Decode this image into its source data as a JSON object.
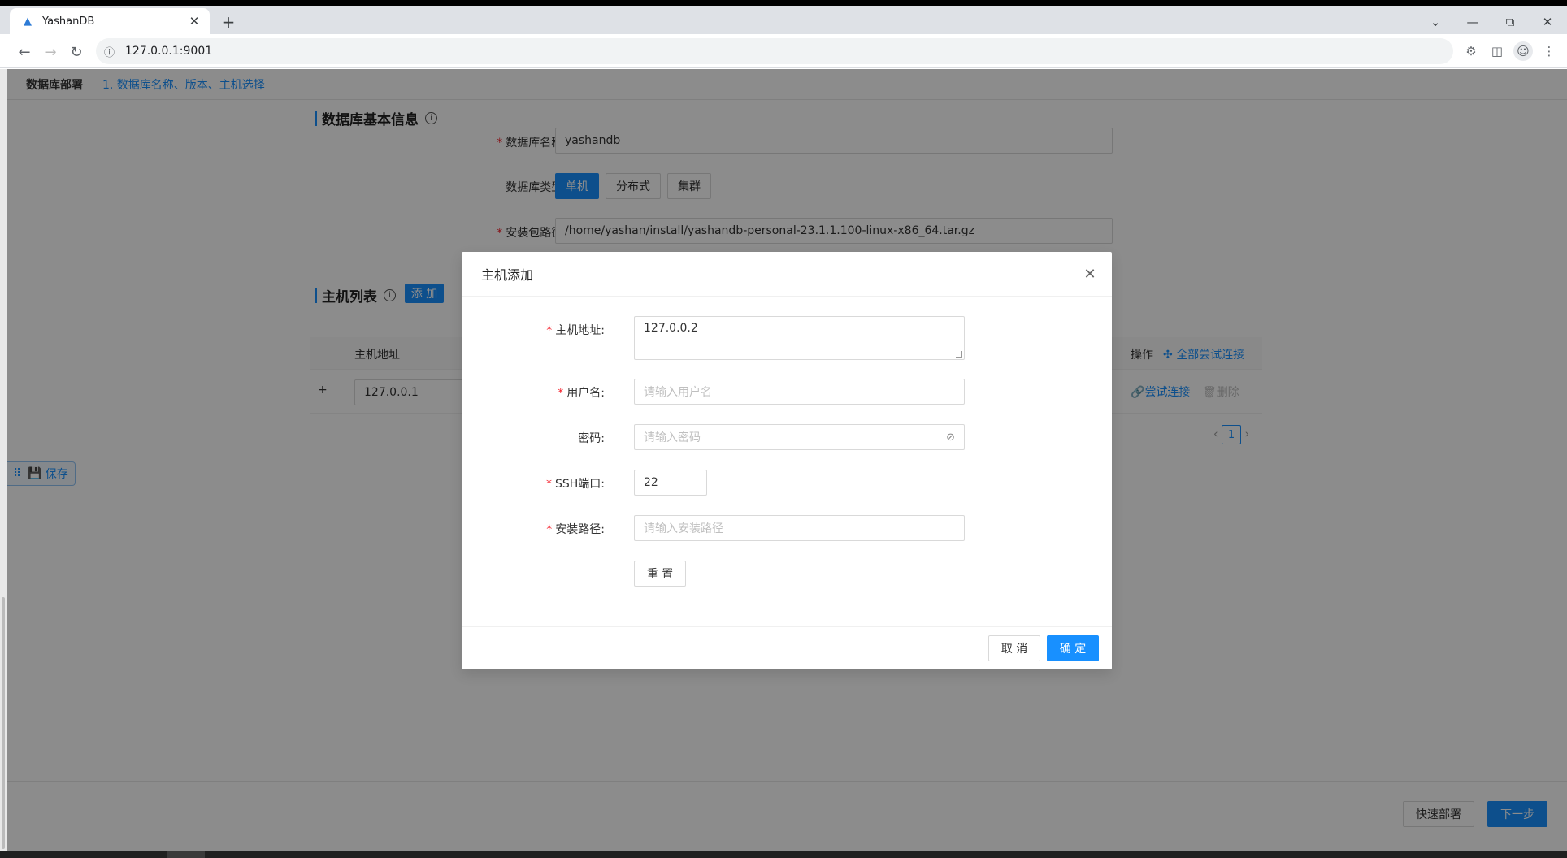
{
  "browser": {
    "tab_title": "YashanDB",
    "url": "127.0.0.1:9001"
  },
  "app": {
    "header_title": "数据库部署",
    "current_step": "1. 数据库名称、版本、主机选择",
    "basic_section": {
      "title": "数据库基本信息",
      "name_label": "数据库名称:",
      "name_value": "yashandb",
      "type_label": "数据库类型:",
      "types": [
        "单机",
        "分布式",
        "集群"
      ],
      "selected_type": "单机",
      "package_label": "安装包路径:",
      "package_value": "/home/yashan/install/yashandb-personal-23.1.1.100-linux-x86_64.tar.gz"
    },
    "host_section": {
      "title": "主机列表",
      "add_label": "添 加",
      "col_host": "主机地址",
      "col_ops": "操作",
      "test_all_label": "全部尝试连接",
      "rows": [
        {
          "expand": "+",
          "host": "127.0.0.1",
          "test_label": "尝试连接",
          "delete_label": "删除"
        }
      ],
      "page": "1"
    },
    "save_label": "保存",
    "footer": {
      "quick_deploy_label": "快速部署",
      "next_label": "下一步"
    }
  },
  "modal": {
    "title": "主机添加",
    "host_label": "主机地址:",
    "host_value": "127.0.0.2",
    "user_label": "用户名:",
    "user_placeholder": "请输入用户名",
    "password_label": "密码:",
    "password_placeholder": "请输入密码",
    "ssh_label": "SSH端口:",
    "ssh_value": "22",
    "path_label": "安装路径:",
    "path_placeholder": "请输入安装路径",
    "reset_label": "重 置",
    "cancel_label": "取 消",
    "ok_label": "确 定"
  },
  "colors": {
    "primary": "#1890ff",
    "required": "#f5222d"
  }
}
